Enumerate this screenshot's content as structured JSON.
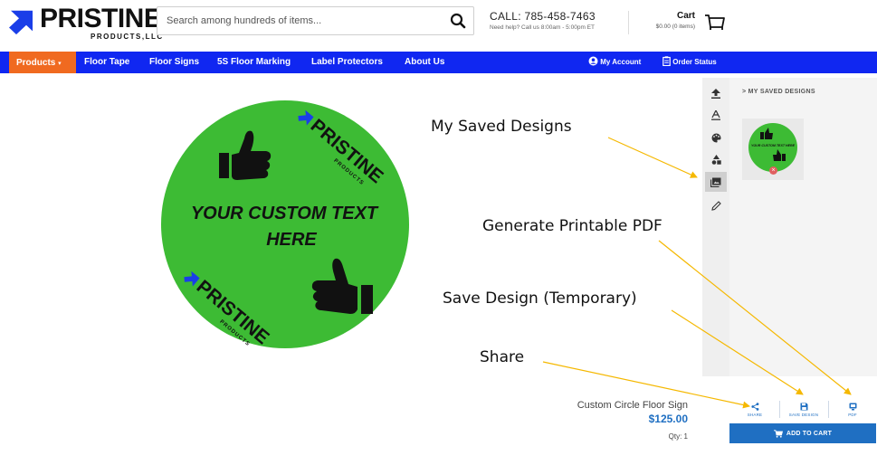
{
  "header": {
    "logo_word": "PRISTINE",
    "logo_sub": "PRODUCTS,LLC",
    "search_placeholder": "Search among hundreds of items...",
    "call_main": "CALL: 785-458-7463",
    "call_sub": "Need help? Call us 8:00am - 5:00pm ET",
    "cart_title": "Cart",
    "cart_sub": "$0.00 (0 items)"
  },
  "nav": {
    "items": [
      "Products",
      "Floor Tape",
      "Floor Signs",
      "5S Floor Marking",
      "Label Protectors",
      "About Us"
    ],
    "account": "My Account",
    "order_status": "Order Status"
  },
  "design": {
    "custom_text_line1": "YOUR CUSTOM TEXT",
    "custom_text_line2": "HERE",
    "brand_word": "PRISTINE",
    "brand_sub": "PRODUCTS",
    "circle_color": "#3dbb34"
  },
  "toolbar": {
    "icons": [
      "upload-icon",
      "text-icon",
      "palette-icon",
      "shapes-icon",
      "saved-designs-icon",
      "edit-pencil-icon"
    ],
    "active_index": 4
  },
  "saved_panel": {
    "title": "> MY SAVED DESIGNS",
    "thumb_text": "YOUR CUSTOM TEXT HERE"
  },
  "annotations": {
    "saved": "My Saved Designs",
    "pdf": "Generate Printable PDF",
    "save": "Save Design (Temporary)",
    "share": "Share"
  },
  "product": {
    "name": "Custom Circle Floor Sign",
    "price": "$125.00",
    "qty": "Qty: 1"
  },
  "actions": {
    "share": "SHARE",
    "save": "SAVE DESIGN",
    "pdf": "PDF",
    "add_to_cart": "ADD TO CART"
  },
  "colors": {
    "nav_blue": "#1027f1",
    "products_orange": "#f06a20",
    "accent_blue": "#1f6fc2",
    "arrow_yellow": "#f5b800"
  }
}
